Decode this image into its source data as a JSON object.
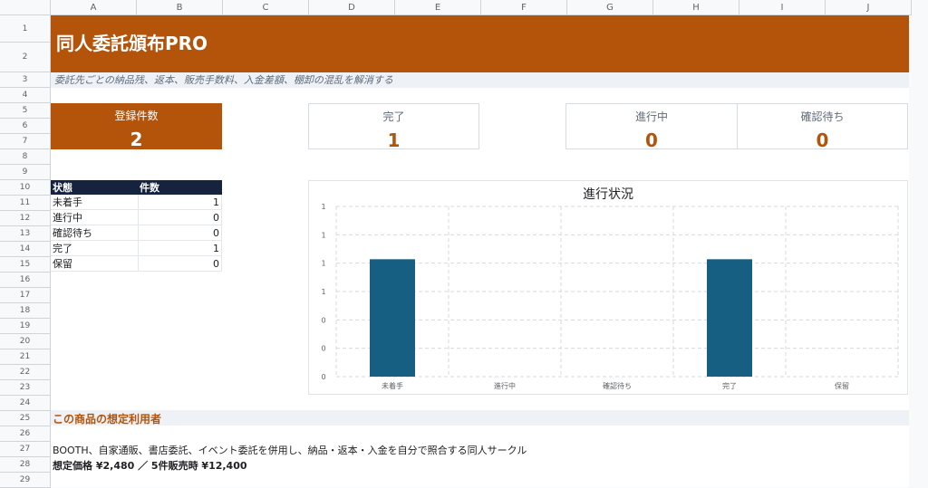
{
  "columns": [
    "A",
    "B",
    "C",
    "D",
    "E",
    "F",
    "G",
    "H",
    "I",
    "J"
  ],
  "rows": [
    "1",
    "2",
    "3",
    "4",
    "5",
    "6",
    "7",
    "8",
    "9",
    "10",
    "11",
    "12",
    "13",
    "14",
    "15",
    "16",
    "17",
    "18",
    "19",
    "20",
    "21",
    "22",
    "23",
    "24",
    "25",
    "26",
    "27",
    "28",
    "29"
  ],
  "banner": {
    "title": "同人委託頒布PRO"
  },
  "subtitle": "委託先ごとの納品残、返本、販売手数料、入金差額、棚卸の混乱を解消する",
  "kpis": {
    "registered": {
      "label": "登録件数",
      "value": "2"
    },
    "done": {
      "label": "完了",
      "value": "1"
    },
    "in_progress": {
      "label": "進行中",
      "value": "0"
    },
    "awaiting": {
      "label": "確認待ち",
      "value": "0"
    }
  },
  "status_table": {
    "headers": [
      "状態",
      "件数"
    ],
    "rows": [
      {
        "status": "未着手",
        "count": "1"
      },
      {
        "status": "進行中",
        "count": "0"
      },
      {
        "status": "確認待ち",
        "count": "0"
      },
      {
        "status": "完了",
        "count": "1"
      },
      {
        "status": "保留",
        "count": "0"
      }
    ]
  },
  "chart_data": {
    "type": "bar",
    "title": "進行状況",
    "categories": [
      "未着手",
      "進行中",
      "確認待ち",
      "完了",
      "保留"
    ],
    "values": [
      1,
      0,
      0,
      1,
      0
    ],
    "yticks": [
      "1",
      "1",
      "1",
      "1",
      "0",
      "0",
      "0"
    ],
    "ylim": [
      0,
      1.2
    ],
    "grid": true,
    "bar_color": "#175f82"
  },
  "footer": {
    "section_title": "この商品の想定利用者",
    "users": "BOOTH、自家通販、書店委託、イベント委託を併用し、納品・返本・入金を自分で照合する同人サークル",
    "price": "想定価格 ¥2,480 ／ 5件販売時 ¥12,400"
  },
  "colors": {
    "accent": "#b4540b",
    "header_dark": "#16233f",
    "bar": "#175f82"
  }
}
